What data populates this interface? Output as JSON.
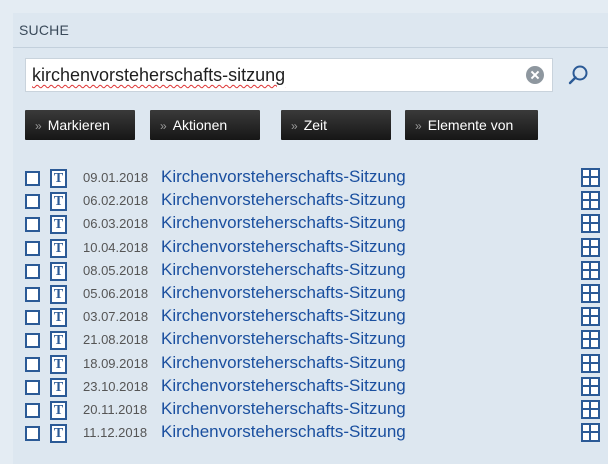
{
  "panel": {
    "title": "SUCHE"
  },
  "search": {
    "value": "kirchenvorsteherschafts-sitzung"
  },
  "toolbar": {
    "buttons": [
      {
        "label": "Markieren"
      },
      {
        "label": "Aktionen"
      },
      {
        "label": "Zeit"
      },
      {
        "label": "Elemente von"
      }
    ]
  },
  "results": [
    {
      "date": "09.01.2018",
      "title": "Kirchenvorsteherschafts-Sitzung"
    },
    {
      "date": "06.02.2018",
      "title": "Kirchenvorsteherschafts-Sitzung"
    },
    {
      "date": "06.03.2018",
      "title": "Kirchenvorsteherschafts-Sitzung"
    },
    {
      "date": "10.04.2018",
      "title": "Kirchenvorsteherschafts-Sitzung"
    },
    {
      "date": "08.05.2018",
      "title": "Kirchenvorsteherschafts-Sitzung"
    },
    {
      "date": "05.06.2018",
      "title": "Kirchenvorsteherschafts-Sitzung"
    },
    {
      "date": "03.07.2018",
      "title": "Kirchenvorsteherschafts-Sitzung"
    },
    {
      "date": "21.08.2018",
      "title": "Kirchenvorsteherschafts-Sitzung"
    },
    {
      "date": "18.09.2018",
      "title": "Kirchenvorsteherschafts-Sitzung"
    },
    {
      "date": "23.10.2018",
      "title": "Kirchenvorsteherschafts-Sitzung"
    },
    {
      "date": "20.11.2018",
      "title": "Kirchenvorsteherschafts-Sitzung"
    },
    {
      "date": "11.12.2018",
      "title": "Kirchenvorsteherschafts-Sitzung"
    }
  ],
  "icons": {
    "row_type": "text-document-icon",
    "row_action": "grid-view-icon",
    "search": "search-icon",
    "clear": "clear-icon"
  },
  "colors": {
    "panel_bg": "#dde7f0",
    "link": "#1a4f9f",
    "icon": "#2b5a96",
    "button_bg": "#1e1e1e"
  }
}
